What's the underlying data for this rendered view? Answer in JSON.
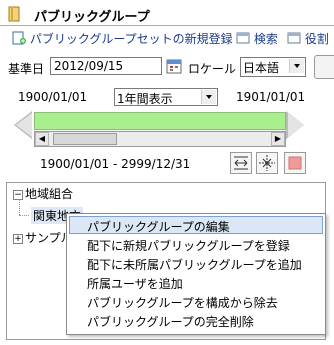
{
  "title": "パブリックグループ",
  "toolbar": {
    "new_set": "パブリックグループセットの新規登録",
    "search": "検索",
    "role": "役割"
  },
  "form": {
    "base_date_label": "基準日",
    "base_date_value": "2012/09/15",
    "locale_label": "ロケール",
    "locale_value": "日本語"
  },
  "timeline": {
    "start_date": "1900/01/01",
    "end_date": "1901/01/01",
    "period_select": "1年間表示",
    "range_text": "1900/01/01 - 2999/12/31"
  },
  "tree": {
    "root": "地域組合",
    "child": "関東地方",
    "sample": "サンプル"
  },
  "context_menu": {
    "items": [
      "パブリックグループの編集",
      "配下に新規パブリックグループを登録",
      "配下に未所属パブリックグループを追加",
      "所属ユーザを追加",
      "パブリックグループを構成から除去",
      "パブリックグループの完全削除"
    ]
  }
}
